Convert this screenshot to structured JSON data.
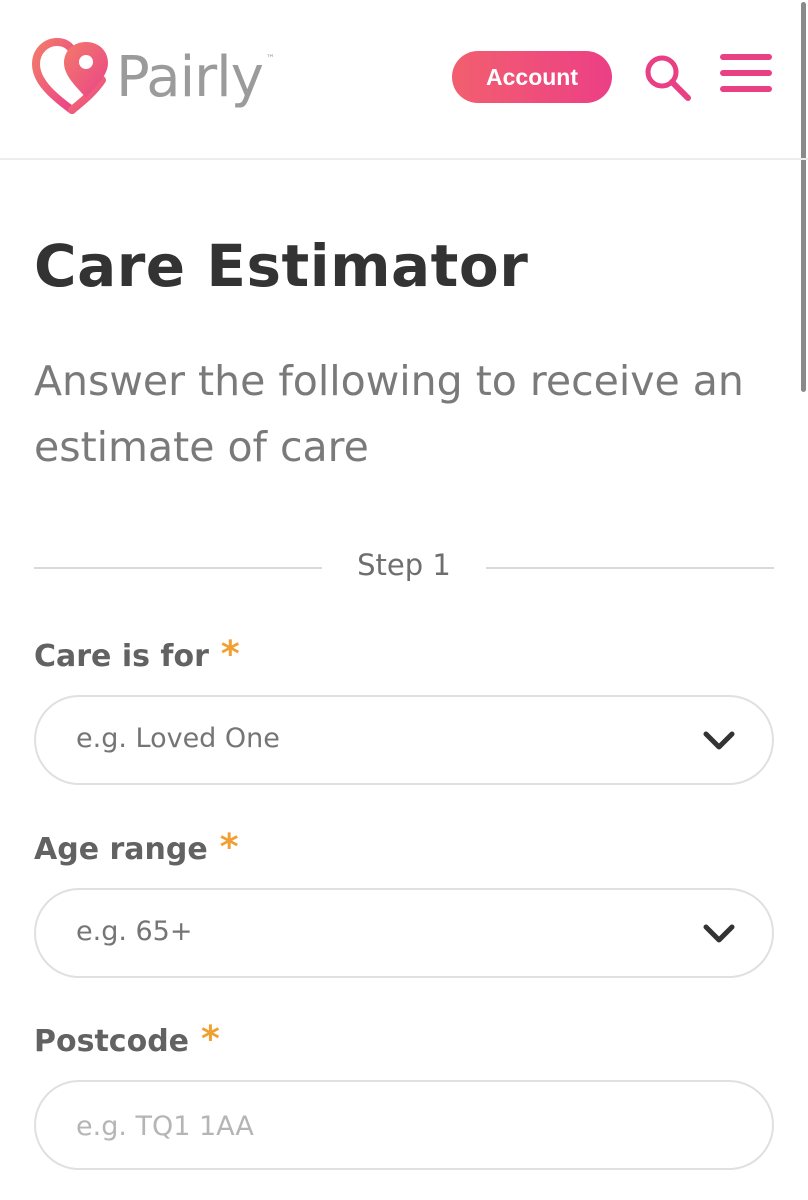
{
  "header": {
    "brand": "Pairly",
    "trademark": "™",
    "account_label": "Account",
    "colors": {
      "accent_start": "#f25f6e",
      "accent_end": "#ec3f86",
      "menu": "#e94084"
    }
  },
  "page": {
    "title": "Care Estimator",
    "subtitle": "Answer the following to receive an estimate of care"
  },
  "step": {
    "label": "Step 1"
  },
  "form": {
    "required_marker": "*",
    "care_for": {
      "label": "Care is for",
      "placeholder": "e.g. Loved One"
    },
    "age_range": {
      "label": "Age range",
      "placeholder": "e.g. 65+"
    },
    "postcode": {
      "label": "Postcode",
      "placeholder": "e.g. TQ1 1AA"
    }
  },
  "icons": [
    "pairly-logo-icon",
    "search-icon",
    "menu-icon",
    "chevron-down-icon"
  ]
}
